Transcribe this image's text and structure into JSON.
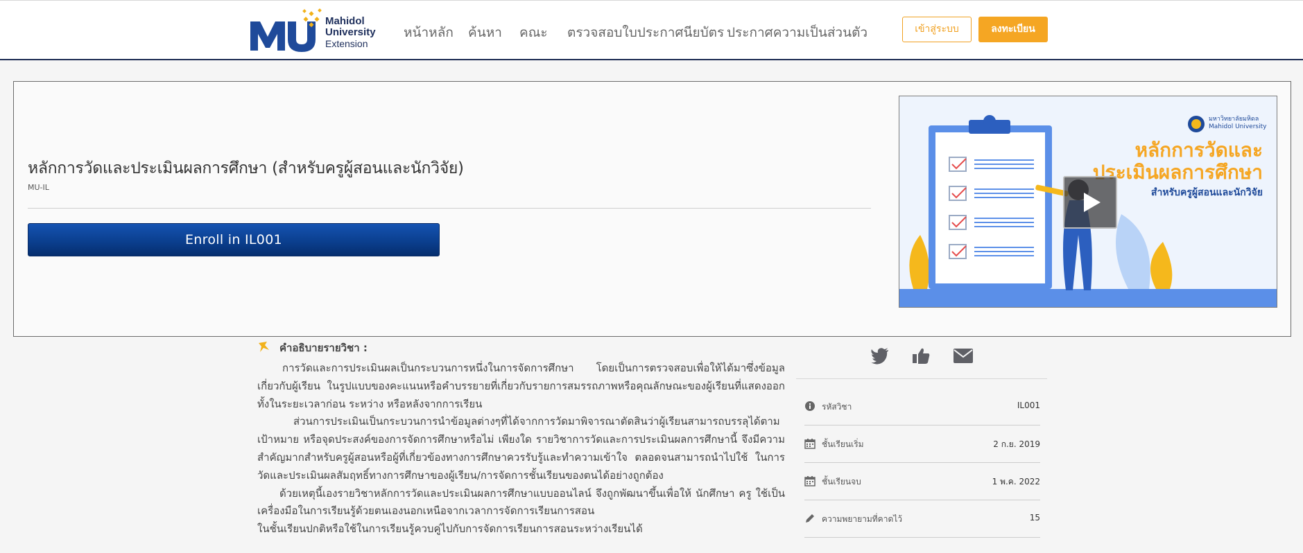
{
  "header": {
    "logo": {
      "mark": "MU",
      "line1": "Mahidol",
      "line2": "University",
      "line3": "Extension"
    },
    "nav": [
      "หน้าหลัก",
      "ค้นหา",
      "คณะ",
      "ตรวจสอบใบประกาศนียบัตร",
      "ประกาศความเป็นส่วนตัว"
    ],
    "login_label": "เข้าสู่ระบบ",
    "register_label": "ลงทะเบียน",
    "accent_color": "#f5a623",
    "brand_color": "#1e2f5c"
  },
  "course": {
    "title": "หลักการวัดและประเมินผลการศึกษา (สำหรับครูผู้สอนและนักวิจัย)",
    "org": "MU-IL",
    "enroll_label": "Enroll in IL001",
    "media": {
      "university_th": "มหาวิทยาลัยมหิดล",
      "university_en": "Mahidol University",
      "headline_1": "หลักการวัดและ",
      "headline_2": "ประเมินผลการศึกษา",
      "subhead": "สำหรับครูผู้สอนและนักวิจัย",
      "play_icon": "play-icon"
    }
  },
  "description": {
    "heading": "คำอธิบายรายวิชา :",
    "paragraphs": [
      "การวัดและการประเมินผลเป็นกระบวนการหนึ่งในการจัดการศึกษา โดยเป็นการตรวจสอบเพื่อให้ได้มาซึ่งข้อมูลเกี่ยวกับผู้เรียน ในรูปแบบของคะแนนหรือคำบรรยายที่เกี่ยวกับรายการสมรรถภาพหรือคุณลักษณะของผู้เรียนที่แสดงออกทั้งในระยะเวลาก่อน ระหว่าง หรือหลังจากการเรียน",
      "ส่วนการประเมินเป็นกระบวนการนำข้อมูลต่างๆที่ได้จากการวัดมาพิจารณาตัดสินว่าผู้เรียนสามารถบรรลุได้ตามเป้าหมาย หรือจุดประสงค์ของการจัดการศึกษาหรือไม่ เพียงใด รายวิชาการวัดและการประเมินผลการศึกษานี้ จึงมีความสำคัญมากสำหรับครูผู้สอนหรือผู้ที่เกี่ยวข้องทางการศึกษาควรรับรู้และทำความเข้าใจ ตลอดจนสามารถนำไปใช้ ในการวัดและประเมินผลสัมฤทธิ์ทางการศึกษาของผู้เรียน/การจัดการชั้นเรียนของตนได้อย่างถูกต้อง",
      "ด้วยเหตุนี้เองรายวิชาหลักการวัดและประเมินผลการศึกษาแบบออนไลน์ จึงถูกพัฒนาขึ้นเพื่อให้ นักศึกษา ครู ใช้เป็นเครื่องมือในการเรียนรู้ด้วยตนเองนอกเหนือจากเวลาการจัดการเรียนการสอน",
      "ในชั้นเรียนปกติหรือใช้ในการเรียนรู้ควบคู่ไปกับการจัดการเรียนการสอนระหว่างเรียนได้"
    ]
  },
  "share": [
    "twitter-icon",
    "thumbs-up-icon",
    "envelope-icon"
  ],
  "info": [
    {
      "icon": "info-icon",
      "label": "รหัสวิชา",
      "value": "IL001"
    },
    {
      "icon": "calendar-icon",
      "label": "ชั้นเรียนเริ่ม",
      "value": "2 ก.ย. 2019"
    },
    {
      "icon": "calendar-icon",
      "label": "ชั้นเรียนจบ",
      "value": "1 พ.ค. 2022"
    },
    {
      "icon": "pencil-icon",
      "label": "ความพยายามที่คาดไว้",
      "value": "15"
    }
  ]
}
